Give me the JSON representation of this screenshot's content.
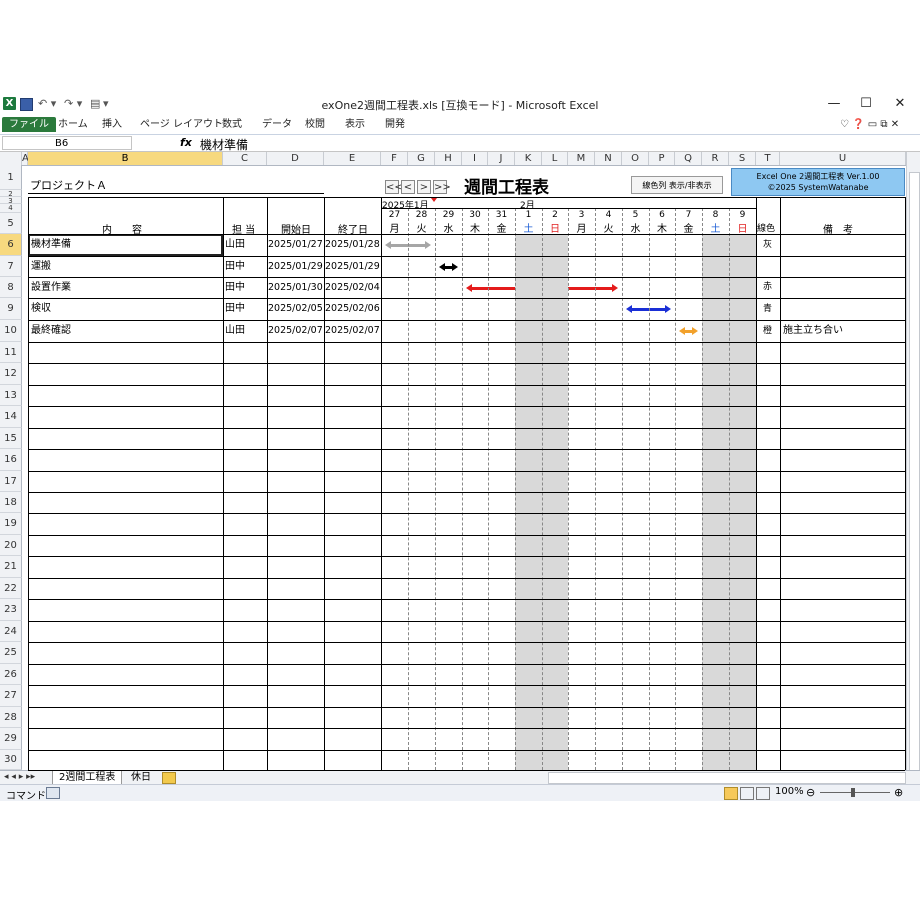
{
  "window": {
    "title": "exOne2週間工程表.xls [互換モード] - Microsoft Excel",
    "minimize": "—",
    "maximize": "☐",
    "close": "✕"
  },
  "qat": {
    "undo": "↶ ▾",
    "redo": "↷ ▾",
    "preview": "▾"
  },
  "ribbon": {
    "tabs": [
      "ファイル",
      "ホーム",
      "挿入",
      "ページ レイアウト",
      "数式",
      "データ",
      "校閲",
      "表示",
      "開発"
    ],
    "right_icons": "♡ ❓ ▭ ⧉ ✕"
  },
  "formula_bar": {
    "name_box": "B6",
    "fx": "fx",
    "value": "機材準備"
  },
  "columns": [
    "A",
    "B",
    "C",
    "D",
    "E",
    "F",
    "G",
    "H",
    "I",
    "J",
    "K",
    "L",
    "M",
    "N",
    "O",
    "P",
    "Q",
    "R",
    "S",
    "T",
    "U"
  ],
  "rows": [
    "1",
    "2",
    "3",
    "4",
    "5",
    "6",
    "7",
    "8",
    "9",
    "10",
    "11",
    "12",
    "13",
    "14",
    "15",
    "16",
    "17",
    "18",
    "19",
    "20",
    "21",
    "22",
    "23",
    "24",
    "25",
    "26",
    "27",
    "28",
    "29",
    "30"
  ],
  "sheet": {
    "project": "プロジェクトＡ",
    "title": "週間工程表",
    "nav": [
      "<<",
      "<",
      ">",
      ">>"
    ],
    "toggle_button": "線色列 表示/非表示",
    "info_line1": "Excel One 2週間工程表 Ver.1.00",
    "info_line2": "©2025 SystemWatanabe",
    "month1": "2025年1月",
    "month2": "2月",
    "headers": {
      "content": "内　　容",
      "person": "担 当",
      "start": "開始日",
      "end": "終了日",
      "color": "線色",
      "note": "備　考"
    },
    "days": [
      {
        "d": "27",
        "w": "月",
        "c": "#000000"
      },
      {
        "d": "28",
        "w": "火",
        "c": "#000000"
      },
      {
        "d": "29",
        "w": "水",
        "c": "#000000"
      },
      {
        "d": "30",
        "w": "木",
        "c": "#000000"
      },
      {
        "d": "31",
        "w": "金",
        "c": "#000000"
      },
      {
        "d": "1",
        "w": "土",
        "c": "#1f5fd6"
      },
      {
        "d": "2",
        "w": "日",
        "c": "#e02020"
      },
      {
        "d": "3",
        "w": "月",
        "c": "#000000"
      },
      {
        "d": "4",
        "w": "火",
        "c": "#000000"
      },
      {
        "d": "5",
        "w": "水",
        "c": "#000000"
      },
      {
        "d": "6",
        "w": "木",
        "c": "#000000"
      },
      {
        "d": "7",
        "w": "金",
        "c": "#000000"
      },
      {
        "d": "8",
        "w": "土",
        "c": "#1f5fd6"
      },
      {
        "d": "9",
        "w": "日",
        "c": "#e02020"
      }
    ],
    "tasks": [
      {
        "name": "機材準備",
        "person": "山田",
        "start": "2025/01/27",
        "end": "2025/01/28",
        "color_name": "灰",
        "note": "",
        "color": "#a6a6a6",
        "from": 0,
        "to": 1
      },
      {
        "name": "運搬",
        "person": "田中",
        "start": "2025/01/29",
        "end": "2025/01/29",
        "color_name": "",
        "note": "",
        "color": "#000000",
        "from": 2,
        "to": 2
      },
      {
        "name": "設置作業",
        "person": "田中",
        "start": "2025/01/30",
        "end": "2025/02/04",
        "color_name": "赤",
        "note": "",
        "color": "#e41b1b",
        "from": 3,
        "to": 8
      },
      {
        "name": "検収",
        "person": "田中",
        "start": "2025/02/05",
        "end": "2025/02/06",
        "color_name": "青",
        "note": "",
        "color": "#1a2fd6",
        "from": 9,
        "to": 10
      },
      {
        "name": "最終確認",
        "person": "山田",
        "start": "2025/02/07",
        "end": "2025/02/07",
        "color_name": "橙",
        "note": "施主立ち合い",
        "color": "#f2a12b",
        "from": 11,
        "to": 11
      }
    ]
  },
  "sheet_tabs": {
    "nav": "◂ ◂ ▸ ▸▸",
    "active": "2週間工程表",
    "other": "休日"
  },
  "status": {
    "mode": "コマンド",
    "zoom": "100%"
  }
}
